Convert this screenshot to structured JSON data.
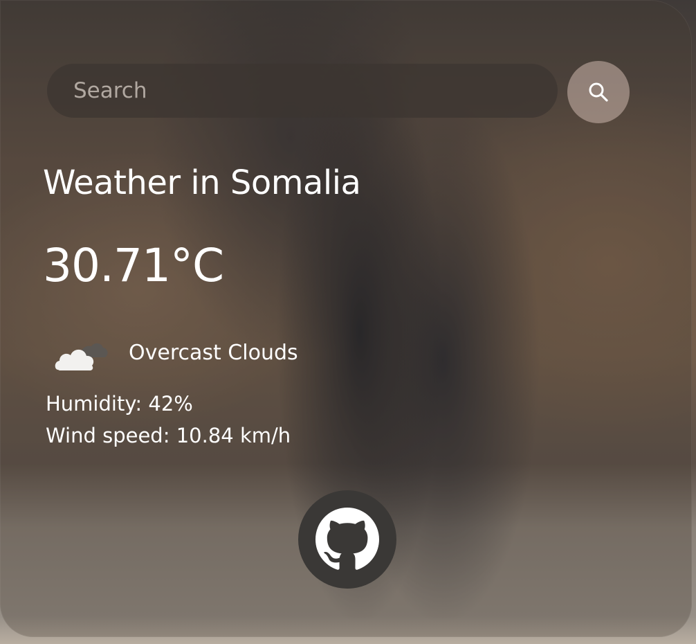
{
  "search": {
    "placeholder": "Search",
    "button_icon": "search-icon"
  },
  "weather": {
    "title": "Weather in Somalia",
    "temperature": "30.71°C",
    "icon": "overcast-clouds-icon",
    "description": "Overcast Clouds",
    "humidity": "Humidity: 42%",
    "wind_speed": "Wind speed: 10.84 km/h"
  },
  "footer": {
    "github_icon": "github-icon"
  },
  "colors": {
    "text": "#ffffff",
    "search_bar_bg": "#3c3430",
    "search_button_bg": "#beaaa0",
    "github_button_bg": "#3a3836"
  }
}
